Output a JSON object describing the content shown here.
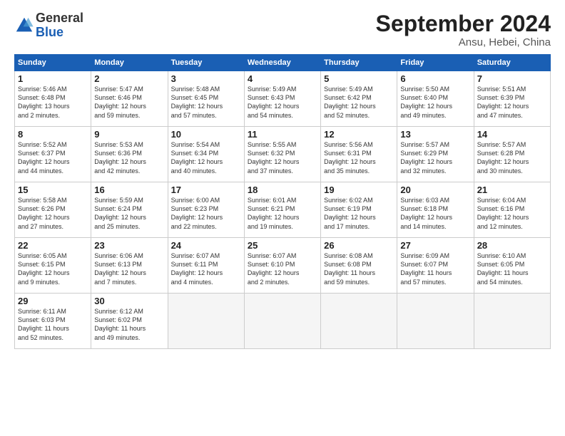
{
  "logo": {
    "general": "General",
    "blue": "Blue"
  },
  "title": "September 2024",
  "location": "Ansu, Hebei, China",
  "days_of_week": [
    "Sunday",
    "Monday",
    "Tuesday",
    "Wednesday",
    "Thursday",
    "Friday",
    "Saturday"
  ],
  "weeks": [
    [
      {
        "num": "1",
        "info": "Sunrise: 5:46 AM\nSunset: 6:48 PM\nDaylight: 13 hours\nand 2 minutes."
      },
      {
        "num": "2",
        "info": "Sunrise: 5:47 AM\nSunset: 6:46 PM\nDaylight: 12 hours\nand 59 minutes."
      },
      {
        "num": "3",
        "info": "Sunrise: 5:48 AM\nSunset: 6:45 PM\nDaylight: 12 hours\nand 57 minutes."
      },
      {
        "num": "4",
        "info": "Sunrise: 5:49 AM\nSunset: 6:43 PM\nDaylight: 12 hours\nand 54 minutes."
      },
      {
        "num": "5",
        "info": "Sunrise: 5:49 AM\nSunset: 6:42 PM\nDaylight: 12 hours\nand 52 minutes."
      },
      {
        "num": "6",
        "info": "Sunrise: 5:50 AM\nSunset: 6:40 PM\nDaylight: 12 hours\nand 49 minutes."
      },
      {
        "num": "7",
        "info": "Sunrise: 5:51 AM\nSunset: 6:39 PM\nDaylight: 12 hours\nand 47 minutes."
      }
    ],
    [
      {
        "num": "8",
        "info": "Sunrise: 5:52 AM\nSunset: 6:37 PM\nDaylight: 12 hours\nand 44 minutes."
      },
      {
        "num": "9",
        "info": "Sunrise: 5:53 AM\nSunset: 6:36 PM\nDaylight: 12 hours\nand 42 minutes."
      },
      {
        "num": "10",
        "info": "Sunrise: 5:54 AM\nSunset: 6:34 PM\nDaylight: 12 hours\nand 40 minutes."
      },
      {
        "num": "11",
        "info": "Sunrise: 5:55 AM\nSunset: 6:32 PM\nDaylight: 12 hours\nand 37 minutes."
      },
      {
        "num": "12",
        "info": "Sunrise: 5:56 AM\nSunset: 6:31 PM\nDaylight: 12 hours\nand 35 minutes."
      },
      {
        "num": "13",
        "info": "Sunrise: 5:57 AM\nSunset: 6:29 PM\nDaylight: 12 hours\nand 32 minutes."
      },
      {
        "num": "14",
        "info": "Sunrise: 5:57 AM\nSunset: 6:28 PM\nDaylight: 12 hours\nand 30 minutes."
      }
    ],
    [
      {
        "num": "15",
        "info": "Sunrise: 5:58 AM\nSunset: 6:26 PM\nDaylight: 12 hours\nand 27 minutes."
      },
      {
        "num": "16",
        "info": "Sunrise: 5:59 AM\nSunset: 6:24 PM\nDaylight: 12 hours\nand 25 minutes."
      },
      {
        "num": "17",
        "info": "Sunrise: 6:00 AM\nSunset: 6:23 PM\nDaylight: 12 hours\nand 22 minutes."
      },
      {
        "num": "18",
        "info": "Sunrise: 6:01 AM\nSunset: 6:21 PM\nDaylight: 12 hours\nand 19 minutes."
      },
      {
        "num": "19",
        "info": "Sunrise: 6:02 AM\nSunset: 6:19 PM\nDaylight: 12 hours\nand 17 minutes."
      },
      {
        "num": "20",
        "info": "Sunrise: 6:03 AM\nSunset: 6:18 PM\nDaylight: 12 hours\nand 14 minutes."
      },
      {
        "num": "21",
        "info": "Sunrise: 6:04 AM\nSunset: 6:16 PM\nDaylight: 12 hours\nand 12 minutes."
      }
    ],
    [
      {
        "num": "22",
        "info": "Sunrise: 6:05 AM\nSunset: 6:15 PM\nDaylight: 12 hours\nand 9 minutes."
      },
      {
        "num": "23",
        "info": "Sunrise: 6:06 AM\nSunset: 6:13 PM\nDaylight: 12 hours\nand 7 minutes."
      },
      {
        "num": "24",
        "info": "Sunrise: 6:07 AM\nSunset: 6:11 PM\nDaylight: 12 hours\nand 4 minutes."
      },
      {
        "num": "25",
        "info": "Sunrise: 6:07 AM\nSunset: 6:10 PM\nDaylight: 12 hours\nand 2 minutes."
      },
      {
        "num": "26",
        "info": "Sunrise: 6:08 AM\nSunset: 6:08 PM\nDaylight: 11 hours\nand 59 minutes."
      },
      {
        "num": "27",
        "info": "Sunrise: 6:09 AM\nSunset: 6:07 PM\nDaylight: 11 hours\nand 57 minutes."
      },
      {
        "num": "28",
        "info": "Sunrise: 6:10 AM\nSunset: 6:05 PM\nDaylight: 11 hours\nand 54 minutes."
      }
    ],
    [
      {
        "num": "29",
        "info": "Sunrise: 6:11 AM\nSunset: 6:03 PM\nDaylight: 11 hours\nand 52 minutes."
      },
      {
        "num": "30",
        "info": "Sunrise: 6:12 AM\nSunset: 6:02 PM\nDaylight: 11 hours\nand 49 minutes."
      },
      {
        "num": "",
        "info": ""
      },
      {
        "num": "",
        "info": ""
      },
      {
        "num": "",
        "info": ""
      },
      {
        "num": "",
        "info": ""
      },
      {
        "num": "",
        "info": ""
      }
    ]
  ]
}
